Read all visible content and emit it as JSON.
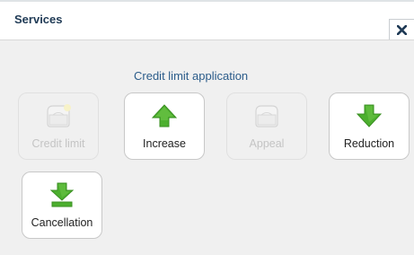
{
  "window": {
    "title": "Services"
  },
  "section": {
    "title": "Credit limit application"
  },
  "tiles": [
    {
      "label": "Credit limit",
      "icon": "folder-star-icon",
      "enabled": false
    },
    {
      "label": "Increase",
      "icon": "arrow-up-icon",
      "enabled": true
    },
    {
      "label": "Appeal",
      "icon": "folder-icon",
      "enabled": false
    },
    {
      "label": "Reduction",
      "icon": "arrow-down-icon",
      "enabled": true
    },
    {
      "label": "Cancellation",
      "icon": "arrow-down-bar-icon",
      "enabled": true
    }
  ],
  "colors": {
    "accent_text": "#2b5c8a",
    "icon_green": "#4caf2e",
    "panel_bg": "#f0f0f0"
  }
}
